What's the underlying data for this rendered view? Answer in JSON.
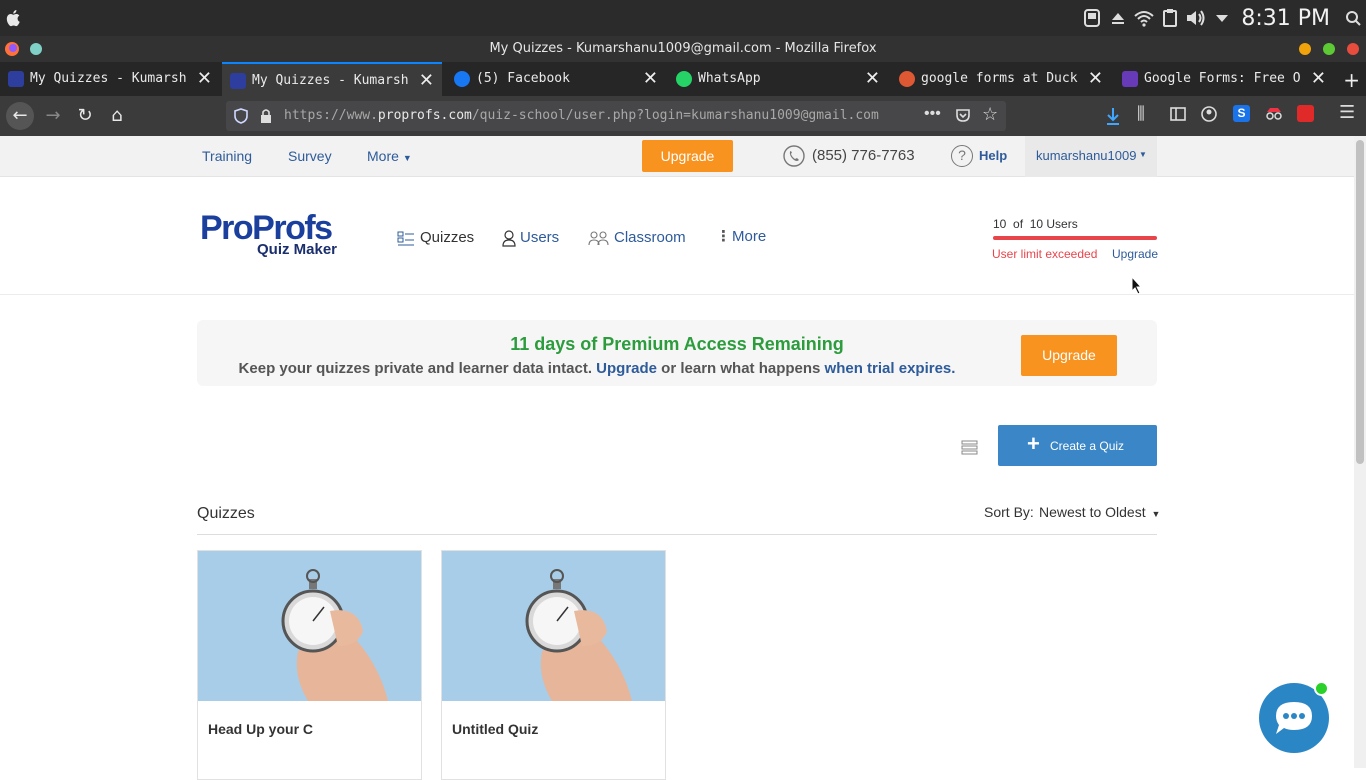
{
  "os": {
    "time": "8:31 PM"
  },
  "window": {
    "title": "My Quizzes - Kumarshanu1009@gmail.com - Mozilla Firefox"
  },
  "tabs": [
    {
      "label": "My Quizzes - Kumarsh",
      "icon": "proprofs-icon",
      "color": "#2d3e9e"
    },
    {
      "label": "My Quizzes - Kumarsh",
      "icon": "proprofs-icon",
      "color": "#2d3e9e"
    },
    {
      "label": "(5) Facebook",
      "icon": "facebook-icon",
      "color": "#1877f2"
    },
    {
      "label": "WhatsApp",
      "icon": "whatsapp-icon",
      "color": "#25d366"
    },
    {
      "label": "google forms at Duck",
      "icon": "duckduckgo-icon",
      "color": "#de5833"
    },
    {
      "label": "Google Forms: Free O",
      "icon": "google-forms-icon",
      "color": "#673ab7"
    }
  ],
  "url": {
    "prefix": "https://www.",
    "domain": "proprofs.com",
    "path": "/quiz-school/user.php?login=kumarshanu1009@gmail.com"
  },
  "topbar": {
    "training": "Training",
    "survey": "Survey",
    "more": "More",
    "upgrade": "Upgrade",
    "phone": "(855) 776-7763",
    "help": "Help",
    "user": "kumarshanu1009"
  },
  "header": {
    "logo_main": "ProProfs",
    "logo_sub": "Quiz Maker",
    "nav": {
      "quizzes": "Quizzes",
      "users": "Users",
      "classroom": "Classroom",
      "more": "More"
    },
    "users_count": "10  of  10 Users",
    "user_limit_fraction": 1.0,
    "limit_text": "User limit exceeded",
    "upgrade_link": "Upgrade"
  },
  "banner": {
    "headline": "11 days of Premium Access Remaining",
    "sub_1": "Keep your quizzes private and learner data intact.",
    "sub_link_1": "Upgrade",
    "sub_2": "or learn what happens",
    "sub_link_2": "when trial expires",
    "sub_end": ".",
    "upgrade_button": "Upgrade"
  },
  "toolbar": {
    "create_quiz": "Create a Quiz"
  },
  "quizzes": {
    "heading": "Quizzes",
    "sort_label": "Sort By:",
    "sort_value": "Newest to Oldest",
    "items": [
      {
        "title": "Head Up your C"
      },
      {
        "title": "Untitled Quiz"
      }
    ]
  },
  "colors": {
    "accent_orange": "#f7931e",
    "link_blue": "#2e5b9a",
    "success_green": "#2c9c3d",
    "warning_red": "#e8454b",
    "button_blue": "#3b86c6"
  }
}
